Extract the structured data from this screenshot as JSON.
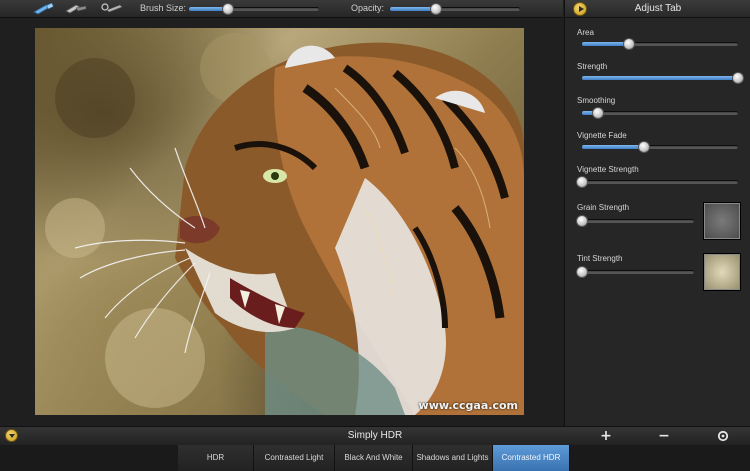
{
  "toolbar": {
    "tools": [
      {
        "icon": "brush-icon"
      },
      {
        "icon": "eraser-icon"
      },
      {
        "icon": "magic-brush-icon"
      }
    ],
    "brush_size_label": "Brush Size:",
    "brush_size_value": 0.3,
    "opacity_label": "Opacity:",
    "opacity_value": 0.35
  },
  "canvas": {
    "watermark": "www.ccgaa.com"
  },
  "panel": {
    "title": "Adjust Tab",
    "params": [
      {
        "label": "Area",
        "value": 0.3
      },
      {
        "label": "Strength",
        "value": 1.0
      },
      {
        "label": "Smoothing",
        "value": 0.1
      },
      {
        "label": "Vignette Fade",
        "value": 0.4
      },
      {
        "label": "Vignette Strength",
        "value": 0.0
      },
      {
        "label": "Grain Strength",
        "value": 0.0
      },
      {
        "label": "Tint Strength",
        "value": 0.0
      }
    ]
  },
  "bottom_bar": {
    "preset_title": "Simply HDR",
    "add_icon": "plus-icon",
    "remove_icon": "minus-icon",
    "reset_icon": "reset-icon"
  },
  "tabs": [
    {
      "label": "HDR"
    },
    {
      "label": "Contrasted Light"
    },
    {
      "label": "Black And White"
    },
    {
      "label": "Shadows and Lights"
    },
    {
      "label": "Contrasted HDR",
      "active": true
    }
  ],
  "colors": {
    "accent": "#4a88c8",
    "panel_bg": "#262626",
    "toggle": "#e0b53a"
  }
}
